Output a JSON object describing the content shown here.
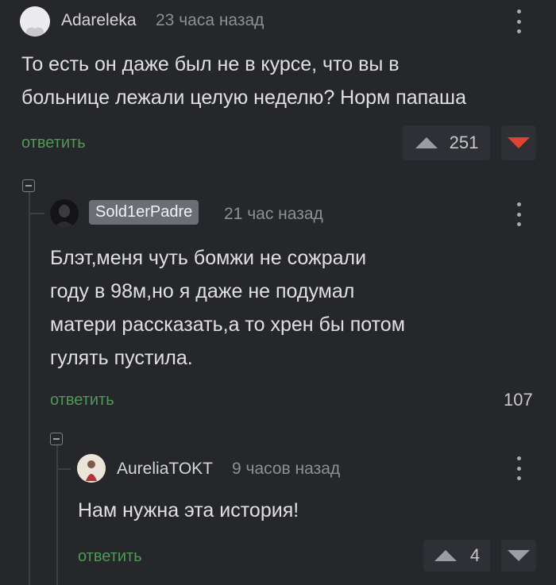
{
  "comments": [
    {
      "author": "Adareleka",
      "time": "23 часа назад",
      "text_lines": [
        "То есть он даже был не в курсе, что вы в",
        "больнице лежали целую неделю? Норм папаша"
      ],
      "reply_label": "ответить",
      "rating": "251",
      "upvote_icon": "triangle-up-icon",
      "downvote_icon": "triangle-down-icon",
      "downvote_color": "#e0432f"
    },
    {
      "author": "Sold1erPadre",
      "time": "21 час назад",
      "text_lines": [
        "Блэт,меня чуть бомжи не сожрали",
        "году в 98м,но я даже не подумал",
        "матери рассказать,а то хрен бы потом",
        "гулять пустила."
      ],
      "reply_label": "ответить",
      "rating": "107"
    },
    {
      "author": "AureliaTOKT",
      "time": "9 часов назад",
      "text_lines": [
        "Нам нужна эта история!"
      ],
      "reply_label": "ответить",
      "rating": "4"
    }
  ],
  "colors": {
    "background": "#25272b",
    "reply_green": "#4f9a55",
    "downvote_active": "#e0432f"
  }
}
